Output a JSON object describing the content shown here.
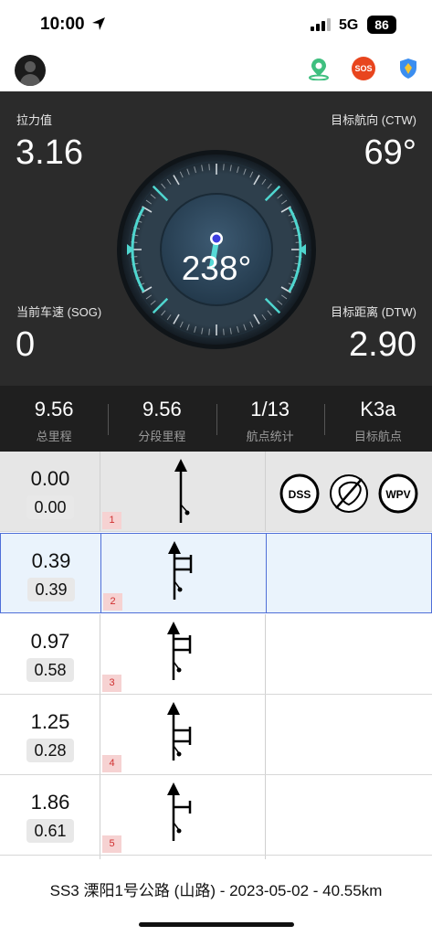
{
  "status_bar": {
    "time": "10:00",
    "network": "5G",
    "battery": "86"
  },
  "icons": {
    "location": "location-arrow-icon",
    "map_pin": "map-pin-icon",
    "sos": "sos-icon",
    "shield": "shield-icon",
    "avatar": "avatar"
  },
  "top_bar": {
    "sos_label": "SOS"
  },
  "dashboard": {
    "pull_label": "拉力值",
    "pull_value": "3.16",
    "ctw_label": "目标航向 (CTW)",
    "ctw_value": "69°",
    "sog_label": "当前车速 (SOG)",
    "sog_value": "0",
    "dtw_label": "目标距离 (DTW)",
    "dtw_value": "2.90",
    "heading": "238°"
  },
  "summary": [
    {
      "value": "9.56",
      "label": "总里程"
    },
    {
      "value": "9.56",
      "label": "分段里程"
    },
    {
      "value": "1/13",
      "label": "航点统计"
    },
    {
      "value": "K3a",
      "label": "目标航点"
    }
  ],
  "rows": [
    {
      "num": "1",
      "total": "0.00",
      "partial": "0.00"
    },
    {
      "num": "2",
      "total": "0.39",
      "partial": "0.39"
    },
    {
      "num": "3",
      "total": "0.97",
      "partial": "0.58"
    },
    {
      "num": "4",
      "total": "1.25",
      "partial": "0.28"
    },
    {
      "num": "5",
      "total": "1.86",
      "partial": "0.61"
    }
  ],
  "row1_notes": {
    "dss": "DSS",
    "wpv": "WPV"
  },
  "footer": {
    "title": "SS3 溧阳1号公路 (山路) - 2023-05-02 - 40.55km"
  },
  "colors": {
    "accent": "#4fd6cf",
    "dashboard_bg": "#2b2b2b",
    "active_row": "#eaf3fc",
    "active_border": "#4f6fd8",
    "sos": "#e8451e"
  }
}
